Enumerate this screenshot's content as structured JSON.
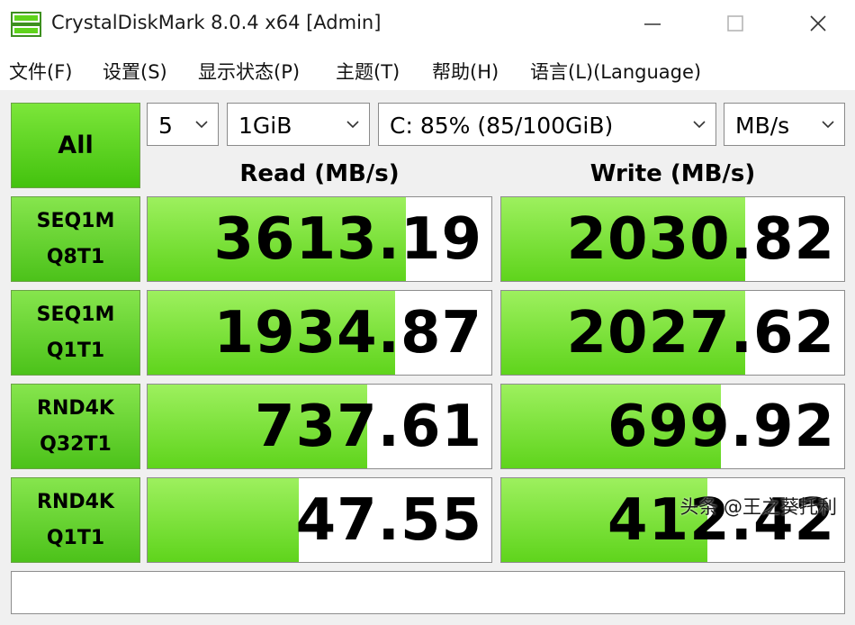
{
  "window": {
    "title": "CrystalDiskMark 8.0.4 x64 [Admin]"
  },
  "menu": [
    "文件(F)",
    "设置(S)",
    "显示状态(P)",
    "主题(T)",
    "帮助(H)",
    "语言(L)(Language)"
  ],
  "controls": {
    "all_label": "All",
    "test_count": "5",
    "test_size": "1GiB",
    "drive": "C: 85% (85/100GiB)",
    "unit": "MB/s"
  },
  "headers": {
    "read": "Read (MB/s)",
    "write": "Write (MB/s)"
  },
  "tests": [
    {
      "line1": "SEQ1M",
      "line2": "Q8T1",
      "read": "3613.19",
      "write": "2030.82",
      "read_fill": 0.75,
      "write_fill": 0.71
    },
    {
      "line1": "SEQ1M",
      "line2": "Q1T1",
      "read": "1934.87",
      "write": "2027.62",
      "read_fill": 0.72,
      "write_fill": 0.71
    },
    {
      "line1": "RND4K",
      "line2": "Q32T1",
      "read": "737.61",
      "write": "699.92",
      "read_fill": 0.64,
      "write_fill": 0.64
    },
    {
      "line1": "RND4K",
      "line2": "Q1T1",
      "read": "47.55",
      "write": "412.42",
      "read_fill": 0.44,
      "write_fill": 0.6
    }
  ],
  "status_text": "",
  "watermark": "头条 @王之葵托利",
  "colors": {
    "accent_green": "#5fd41c",
    "button_green": "#4cc21a"
  }
}
